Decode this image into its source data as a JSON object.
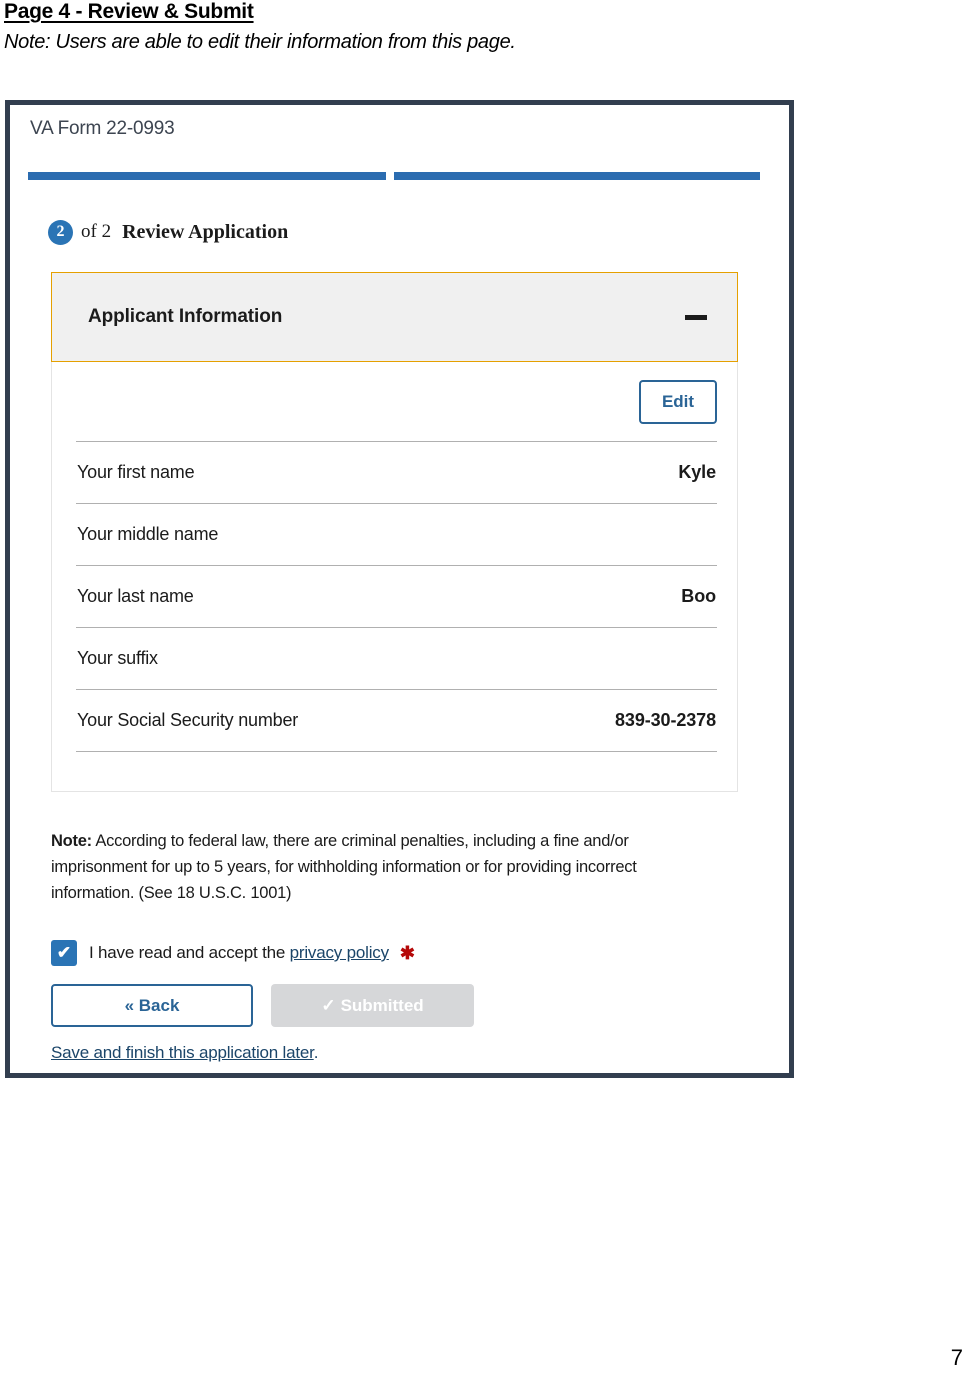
{
  "document": {
    "heading": "Page 4 - Review & Submit",
    "note": "Note: Users are able to edit their information from this page.",
    "page_number": "7"
  },
  "colors": {
    "frame_border": "#323e4f",
    "progress_fill": "#2b6cb0",
    "badge_blue": "#2a74b5",
    "accordion_border": "#e5a000",
    "accordion_bg": "#f0f0f0",
    "link_blue": "#1b4569",
    "button_blue": "#2a6496",
    "checkbox_blue": "#2a74b5",
    "disabled_gray": "#d6d7d9",
    "required_red": "#b50909"
  },
  "form": {
    "form_label": "VA Form 22-0993",
    "progress": {
      "segments": [
        {
          "label": "step-1",
          "complete": true
        },
        {
          "label": "step-2",
          "complete": true
        }
      ]
    },
    "step": {
      "number": "2",
      "of_text": "of 2",
      "title": "Review Application"
    },
    "accordion": {
      "title": "Applicant Information",
      "collapse_icon": "minus-icon",
      "expanded": true,
      "edit_label": "Edit",
      "rows": [
        {
          "label": "Your first name",
          "value": "Kyle"
        },
        {
          "label": "Your middle name",
          "value": ""
        },
        {
          "label": "Your last name",
          "value": "Boo"
        },
        {
          "label": "Your suffix",
          "value": ""
        },
        {
          "label": "Your Social Security number",
          "value": "839-30-2378"
        }
      ]
    },
    "legal_note": {
      "prefix": "Note:",
      "text": " According to federal law, there are criminal penalties, including a fine and/or imprisonment for up to 5 years, for withholding information or for providing incorrect information. (See 18 U.S.C. 1001)"
    },
    "privacy": {
      "checked": true,
      "check_glyph": "✔",
      "text_before": "I have read and accept the ",
      "link_text": "privacy policy",
      "required_marker": "✱"
    },
    "actions": {
      "back_label": "« Back",
      "submit_label": "Submitted",
      "submit_check_glyph": "✓",
      "save_later_link": "Save and finish this application later",
      "save_later_period": "."
    }
  }
}
